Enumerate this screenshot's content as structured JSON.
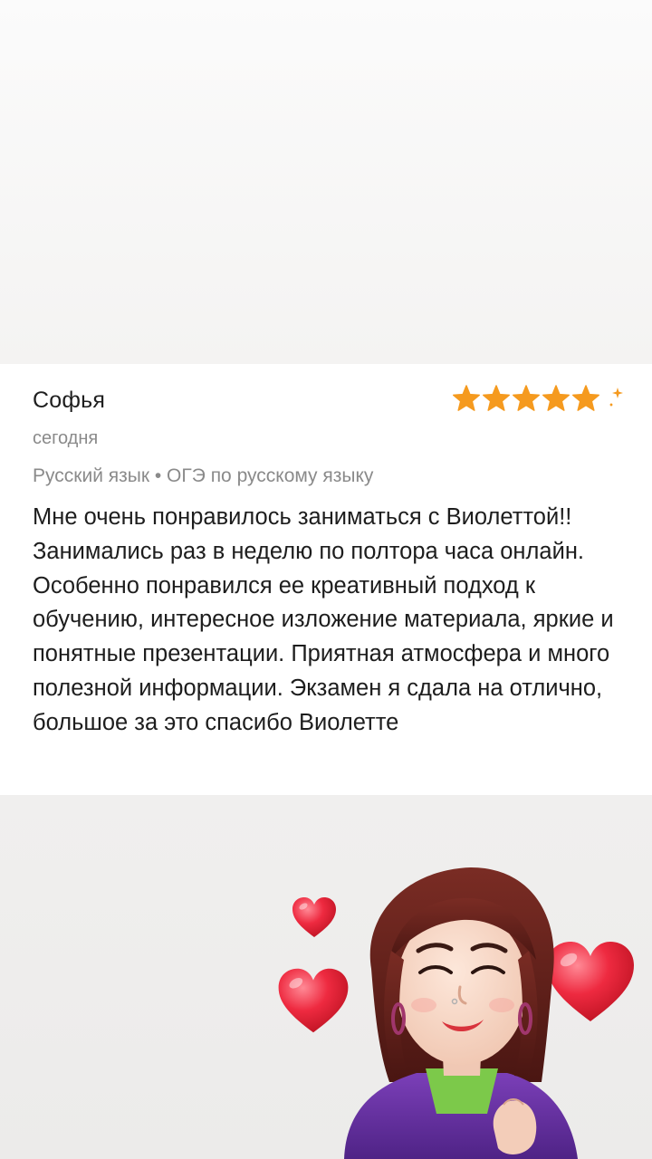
{
  "review": {
    "author": "Софья",
    "date": "сегодня",
    "subject": "Русский язык • ОГЭ по русскому языку",
    "rating": 5,
    "rating_max": 5,
    "star_color": "#f59a1f",
    "text": "Мне очень понравилось заниматься с Виолеттой!! Занимались раз в неделю по полтора часа онлайн. Особенно понравился ее креативный подход к обучению, интересное изложение материала, яркие и понятные презентации. Приятная атмосфера и много полезной информации. Экзамен я сдала на отлично, большое за это спасибо Виолетте"
  },
  "sticker": {
    "icon": "avatar-sticker",
    "decorations": [
      "heart-icon",
      "heart-icon",
      "heart-icon"
    ],
    "heart_color": "#e8253a"
  }
}
